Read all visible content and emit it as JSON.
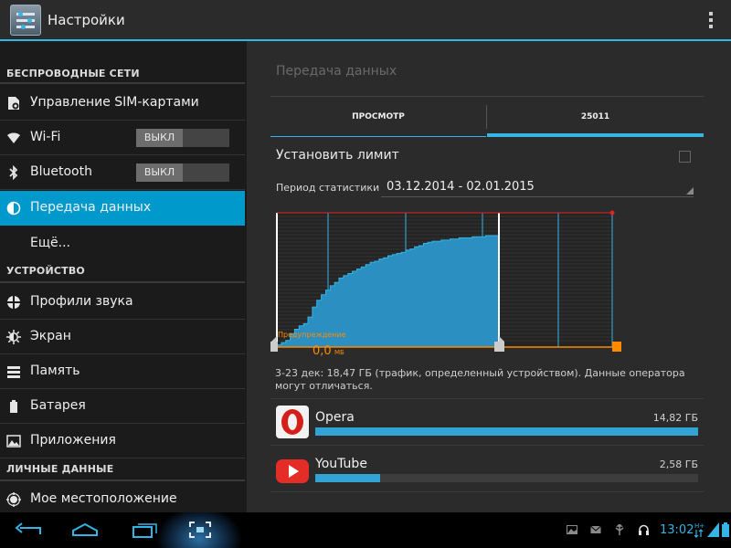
{
  "app": {
    "title": "Настройки"
  },
  "colors": {
    "accent": "#33b5e5",
    "selected": "#0099cc",
    "warning": "#ff8a00",
    "limit": "#e02424"
  },
  "sidebar": {
    "sections": [
      {
        "title": "БЕСПРОВОДНЫЕ СЕТИ"
      },
      {
        "title": "УСТРОЙСТВО"
      },
      {
        "title": "ЛИЧНЫЕ ДАННЫЕ"
      }
    ],
    "items": [
      {
        "label": "Управление SIM-картами",
        "icon": "sim-settings-icon"
      },
      {
        "label": "Wi-Fi",
        "icon": "wifi-icon",
        "toggle": "ВЫКЛ"
      },
      {
        "label": "Bluetooth",
        "icon": "bluetooth-icon",
        "toggle": "ВЫКЛ"
      },
      {
        "label": "Передача данных",
        "icon": "data-usage-icon",
        "selected": true
      },
      {
        "label": "Ещё..."
      },
      {
        "label": "Профили звука",
        "icon": "sound-profile-icon"
      },
      {
        "label": "Экран",
        "icon": "display-icon"
      },
      {
        "label": "Память",
        "icon": "storage-icon"
      },
      {
        "label": "Батарея",
        "icon": "battery-icon"
      },
      {
        "label": "Приложения",
        "icon": "apps-icon"
      },
      {
        "label": "Мое местоположение",
        "icon": "location-icon"
      }
    ]
  },
  "main": {
    "title": "Передача данных",
    "tabs": [
      {
        "label": "ПРОСМОТР",
        "active": false
      },
      {
        "label": "25011",
        "active": true
      }
    ],
    "limit_label": "Установить лимит",
    "limit_checked": false,
    "period_label": "Период статистики",
    "period_value": "03.12.2014 - 02.01.2015",
    "warning": {
      "label": "Предупреждение",
      "value": "0,0",
      "unit": "МБ"
    },
    "summary": "3-23 дек: 18,47 ГБ (трафик, определенный устройством). Данные оператора могут отличаться.",
    "apps": [
      {
        "name": "Opera",
        "size": "14,82 ГБ",
        "usage_fraction": 1.0,
        "icon": "opera-icon"
      },
      {
        "name": "YouTube",
        "size": "2,58 ГБ",
        "usage_fraction": 0.17,
        "icon": "youtube-icon"
      }
    ]
  },
  "chart_data": {
    "type": "area",
    "title": "",
    "xlabel": "",
    "ylabel": "",
    "x": [
      0,
      2,
      4,
      6,
      8,
      10,
      12,
      14,
      16,
      18,
      20,
      22,
      24,
      26,
      28,
      30,
      32,
      34,
      36,
      38,
      40,
      42,
      44,
      46,
      48,
      50,
      52,
      54,
      56,
      58,
      60,
      62,
      64,
      66,
      68,
      70,
      72,
      74,
      76,
      78,
      80,
      82,
      84,
      86,
      88,
      90,
      92,
      94,
      96,
      98,
      100
    ],
    "values": [
      0.02,
      0.04,
      0.06,
      0.12,
      0.16,
      0.19,
      0.21,
      0.27,
      0.36,
      0.42,
      0.47,
      0.51,
      0.55,
      0.58,
      0.62,
      0.64,
      0.66,
      0.68,
      0.7,
      0.72,
      0.74,
      0.76,
      0.77,
      0.79,
      0.8,
      0.82,
      0.83,
      0.84,
      0.85,
      0.87,
      0.88,
      0.9,
      0.91,
      0.93,
      0.94,
      0.95,
      0.95,
      0.96,
      0.96,
      0.97,
      0.97,
      0.98,
      0.98,
      0.98,
      0.99,
      0.99,
      0.99,
      1.0,
      1.0,
      1.0,
      1.0
    ],
    "grid": true
  },
  "nav": {
    "back_icon": "back-icon",
    "home_icon": "home-icon",
    "recents_icon": "recent-apps-icon",
    "screenshot_icon": "screenshot-icon"
  },
  "status": {
    "time": "13:02"
  }
}
